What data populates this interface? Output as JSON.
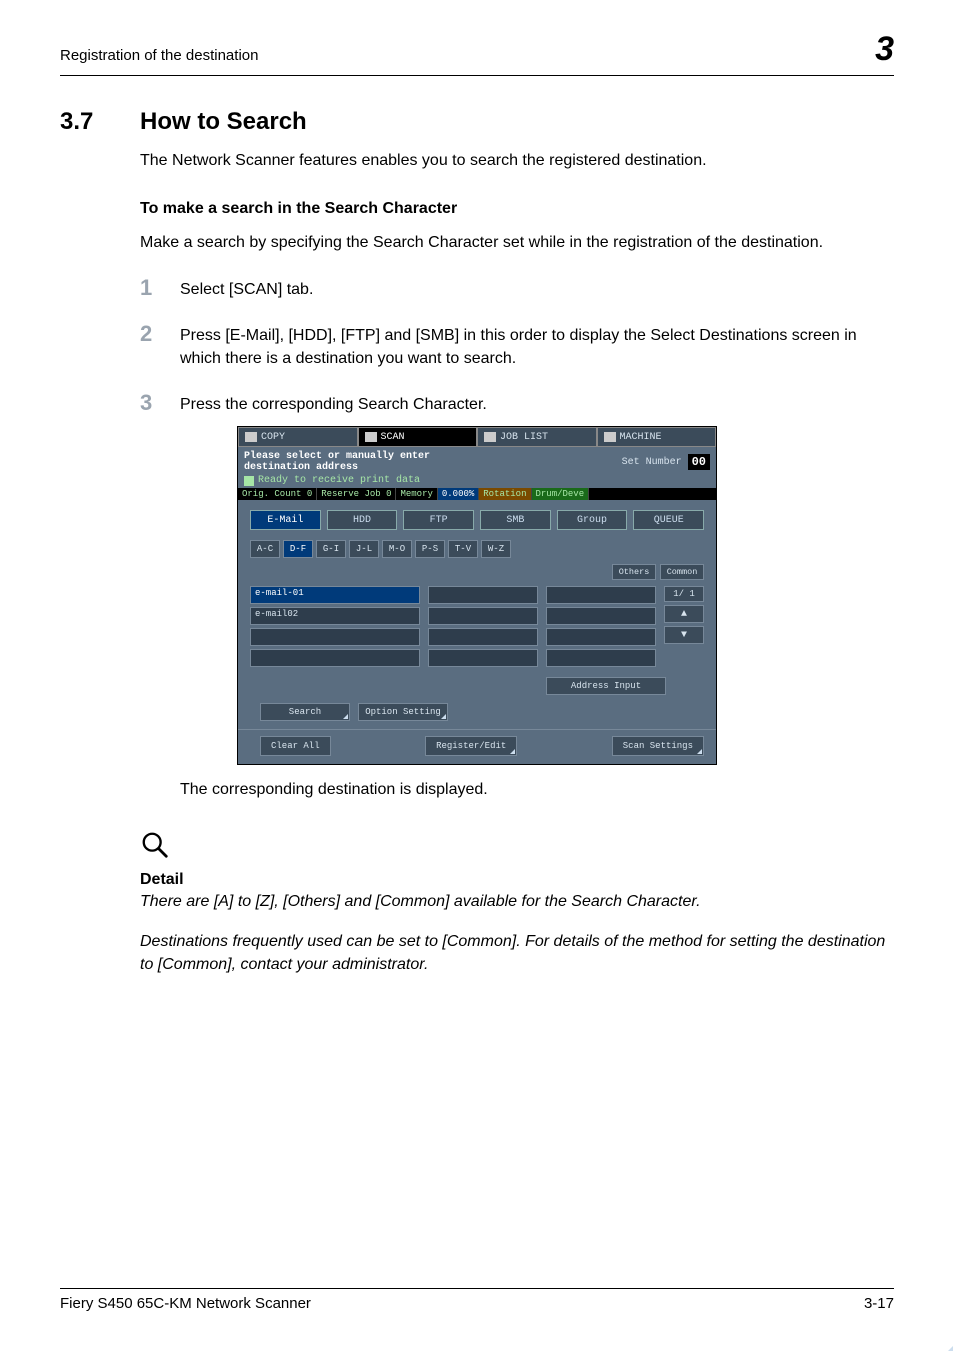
{
  "header": {
    "left": "Registration of the destination",
    "right": "3"
  },
  "h2": {
    "num": "3.7",
    "title": "How to Search"
  },
  "p1": "The Network Scanner features enables you to search the registered destination.",
  "h3": "To make a search in the Search Character",
  "p2": "Make a search by specifying the Search Character set while in the registration of the destination.",
  "steps": {
    "n1": "1",
    "t1": "Select [SCAN] tab.",
    "n2": "2",
    "t2": "Press [E-Mail], [HDD], [FTP] and [SMB] in this order to display the Select Destinations screen in which there is a destination you want to search.",
    "n3": "3",
    "t3": "Press the corresponding Search Character."
  },
  "after": "The corresponding destination is displayed.",
  "detail": {
    "head": "Detail",
    "p1": "There are [A] to [Z], [Others] and [Common] available for the Search Character.",
    "p2": "Destinations frequently used can be set to [Common]. For details of the method for setting the destination to [Common], contact your administrator."
  },
  "footer": {
    "left": "Fiery S450 65C-KM Network Scanner",
    "right": "3-17"
  },
  "shot": {
    "tabs": {
      "copy": "COPY",
      "scan": "SCAN",
      "joblist": "JOB LIST",
      "machine": "MACHINE"
    },
    "msg_l1": "Please select or manually enter",
    "msg_l2": "destination address",
    "setnum_lbl": "Set Number",
    "setnum_val": "00",
    "ready": "Ready to receive print data",
    "stat": {
      "orig": "Orig. Count",
      "origv": "0",
      "resv": "Reserve Job",
      "resvv": "0",
      "mem": "Memory",
      "memv": "0.000%",
      "rot": "Rotation",
      "drum": "Drum/Deve"
    },
    "dest": {
      "email": "E-Mail",
      "hdd": "HDD",
      "ftp": "FTP",
      "smb": "SMB",
      "group": "Group",
      "queue": "QUEUE"
    },
    "alpha": [
      "A-C",
      "D-F",
      "G-I",
      "J-L",
      "M-O",
      "P-S",
      "T-V",
      "W-Z"
    ],
    "others": "Others",
    "common": "Common",
    "list": {
      "i1": "e-mail-01",
      "i2": "e-mail02"
    },
    "page": "1/  1",
    "addr": "Address Input",
    "search": "Search",
    "opt": "Option Setting",
    "clear": "Clear All",
    "reg": "Register/Edit",
    "scanset": "Scan Settings"
  }
}
